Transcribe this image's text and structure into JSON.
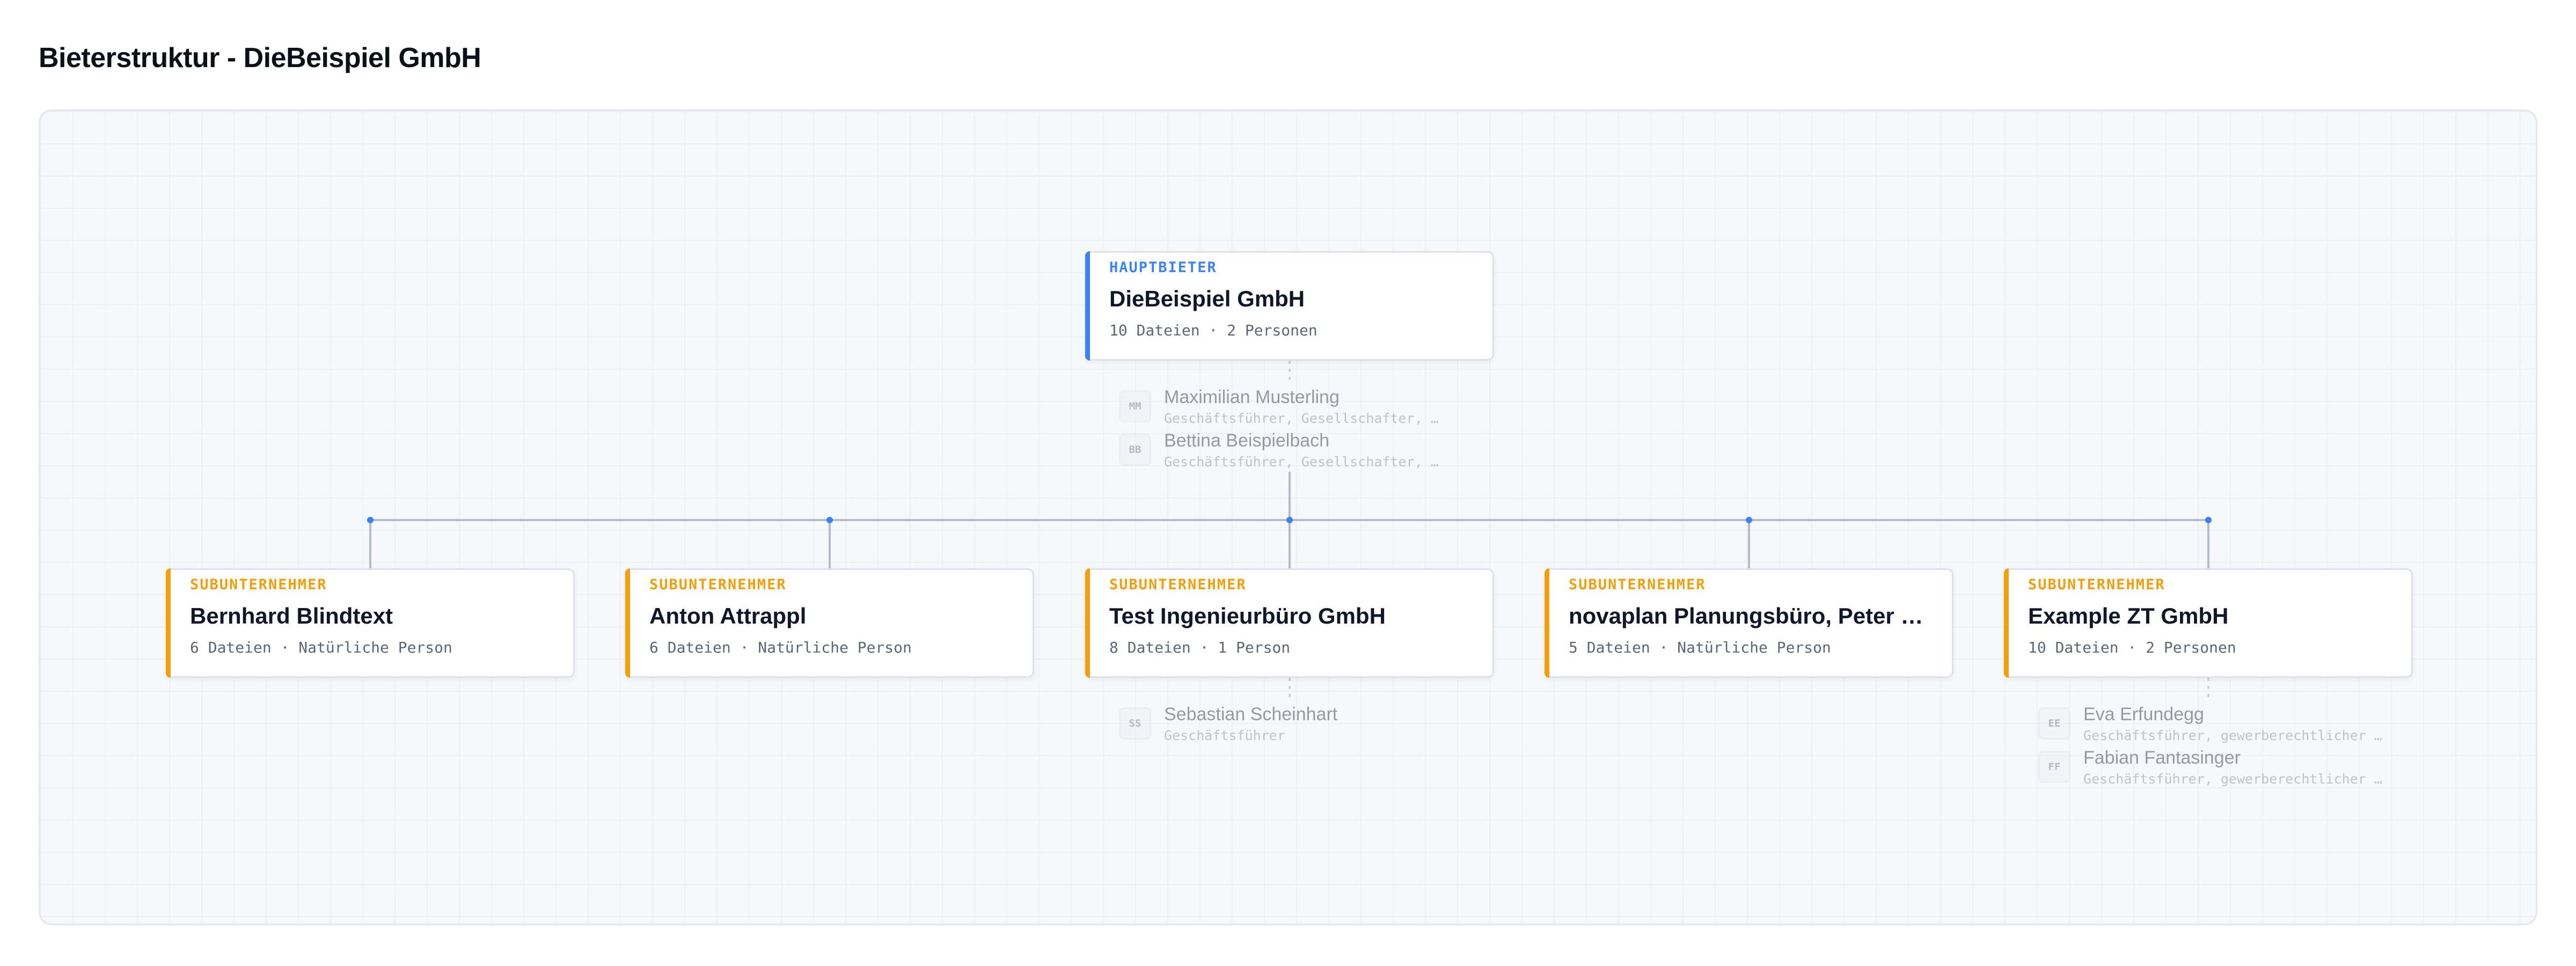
{
  "page": {
    "title": "Bieterstruktur - DieBeispiel GmbH"
  },
  "colors": {
    "main_accent": "#3b82f6",
    "sub_accent": "#f59e0b",
    "connector": "#b4bccb",
    "connector_dot": "#3b82f6"
  },
  "main_bidder": {
    "role": "HAUPTBIETER",
    "name": "DieBeispiel GmbH",
    "meta": "10 Dateien · 2 Personen",
    "persons": [
      {
        "initials": "MM",
        "name": "Maximilian Musterling",
        "role": "Geschäftsführer, Gesellschafter, …"
      },
      {
        "initials": "BB",
        "name": "Bettina Beispielbach",
        "role": "Geschäftsführer, Gesellschafter, …"
      }
    ]
  },
  "subcontractors": [
    {
      "role": "SUBUNTERNEHMER",
      "name": "Bernhard Blindtext",
      "meta": "6 Dateien · Natürliche Person",
      "persons": []
    },
    {
      "role": "SUBUNTERNEHMER",
      "name": "Anton Attrappl",
      "meta": "6 Dateien · Natürliche Person",
      "persons": []
    },
    {
      "role": "SUBUNTERNEHMER",
      "name": "Test Ingenieurbüro GmbH",
      "meta": "8 Dateien · 1 Person",
      "persons": [
        {
          "initials": "SS",
          "name": "Sebastian Scheinhart",
          "role": "Geschäftsführer"
        }
      ]
    },
    {
      "role": "SUBUNTERNEHMER",
      "name": "novaplan Planungsbüro, Peter Planmann",
      "meta": "5 Dateien · Natürliche Person",
      "persons": []
    },
    {
      "role": "SUBUNTERNEHMER",
      "name": "Example ZT GmbH",
      "meta": "10 Dateien · 2 Personen",
      "persons": [
        {
          "initials": "EE",
          "name": "Eva Erfundegg",
          "role": "Geschäftsführer, gewerberechtlicher Geschäftsführer"
        },
        {
          "initials": "FF",
          "name": "Fabian Fantasinger",
          "role": "Geschäftsführer, gewerberechtlicher Geschäftsführer"
        }
      ]
    }
  ]
}
